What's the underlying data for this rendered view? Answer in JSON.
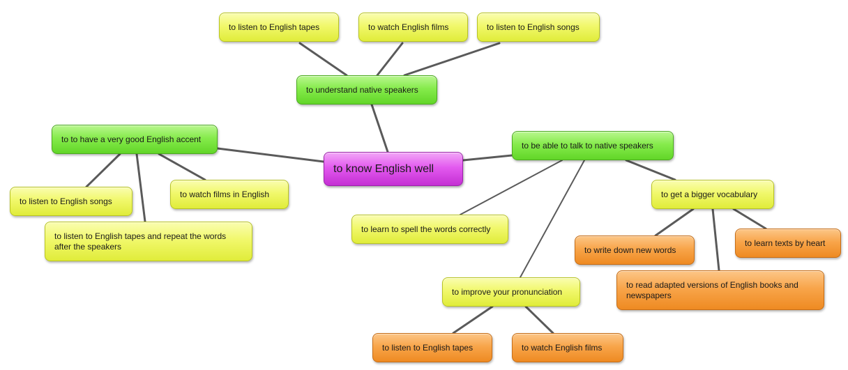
{
  "mindmap": {
    "colors": {
      "root": "#e35aef",
      "level1": "#86eb4c",
      "level2_yellow": "#f1f86c",
      "level2_orange": "#f8a54a",
      "connector": "#5a5a5a"
    },
    "root": {
      "label": "to know English well"
    },
    "branches": {
      "understand": {
        "label": "to understand native speakers",
        "children": [
          "to listen to English tapes",
          "to watch English films",
          "to listen to English songs"
        ]
      },
      "accent": {
        "label": "to to have a very good English accent",
        "children": [
          "to listen to English songs",
          "to watch films in English",
          "to listen to English tapes and repeat the words after the speakers"
        ]
      },
      "talk": {
        "label": "to be able to talk  to native speakers",
        "children": [
          "to learn to spell the words correctly",
          "to get a bigger vocabulary",
          "to improve your pronunciation"
        ]
      },
      "vocabulary": {
        "children": [
          "to write down new words",
          "to learn texts by heart",
          "to read adapted versions of English books and newspapers"
        ]
      },
      "pronunciation": {
        "children": [
          "to listen to English tapes",
          "to  watch English films"
        ]
      }
    }
  }
}
